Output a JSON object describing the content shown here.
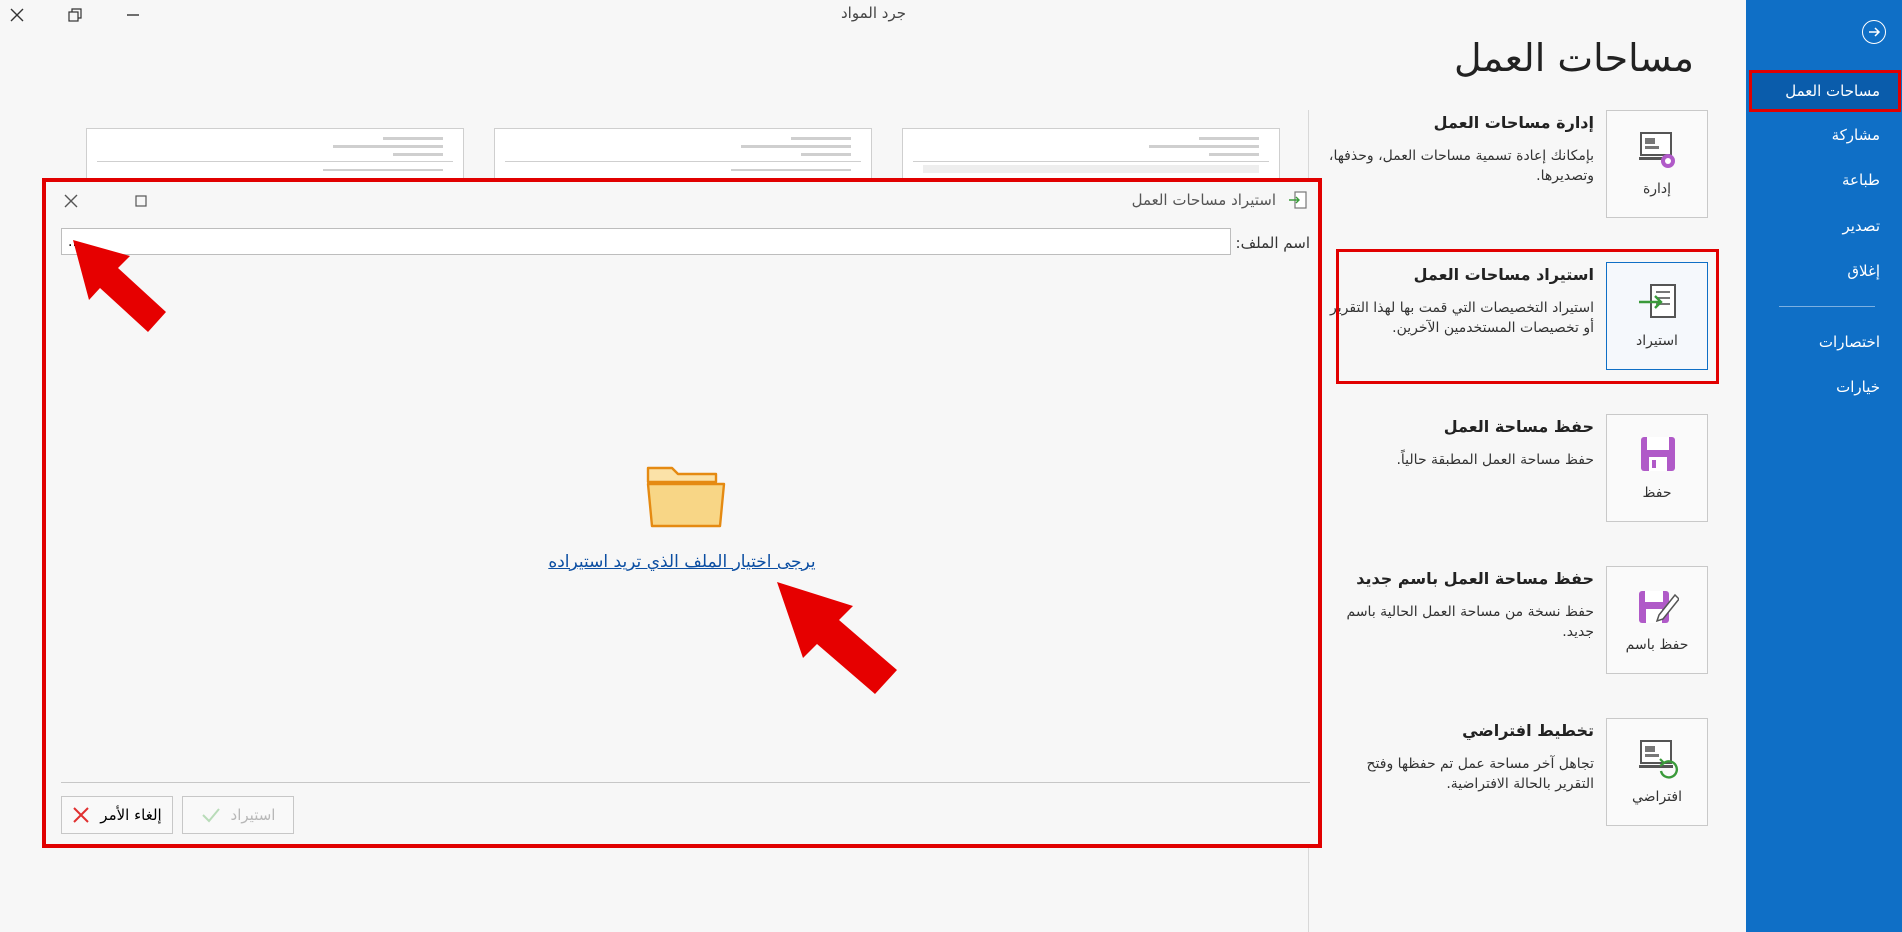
{
  "window": {
    "title": "جرد المواد"
  },
  "sidebar": {
    "items": [
      {
        "label": "مساحات العمل"
      },
      {
        "label": "مشاركة"
      },
      {
        "label": "طباعة"
      },
      {
        "label": "تصدير"
      },
      {
        "label": "إغلاق"
      },
      {
        "label": "اختصارات"
      },
      {
        "label": "خيارات"
      }
    ]
  },
  "page": {
    "title": "مساحات العمل"
  },
  "options": [
    {
      "title": "إدارة مساحات العمل",
      "description": "بإمكانك إعادة تسمية مساحات العمل، وحذفها، وتصديرها.",
      "button": "إدارة",
      "icon": "manage-workspaces-icon"
    },
    {
      "title": "استيراد مساحات العمل",
      "description": "استيراد التخصيصات التي قمت بها لهذا التقرير أو تخصيصات المستخدمين الآخرين.",
      "button": "استيراد",
      "icon": "import-icon"
    },
    {
      "title": "حفظ مساحة العمل",
      "description": "حفظ مساحة العمل المطبقة حالياً.",
      "button": "حفظ",
      "icon": "save-icon"
    },
    {
      "title": "حفظ مساحة العمل باسم جديد",
      "description": "حفظ نسخة من مساحة العمل الحالية باسم جديد.",
      "button": "حفظ باسم",
      "icon": "save-as-icon"
    },
    {
      "title": "تخطيط افتراضي",
      "description": "تجاهل آخر مساحة عمل تم حفظها وفتح التقرير بالحالة الافتراضية.",
      "button": "افتراضي",
      "icon": "default-layout-icon"
    }
  ],
  "dialog": {
    "title": "استيراد مساحات العمل",
    "file_label": "اسم الملف:",
    "file_value": "...",
    "choose_file_link": "يرجى اختيار الملف الذي تريد استيراده",
    "import_button": "استيراد",
    "cancel_button": "إلغاء الأمر"
  },
  "colors": {
    "sidebar": "#0f6fc6",
    "highlight": "#e10000",
    "link": "#0b4ea2",
    "folder": "#f6cf7a"
  }
}
